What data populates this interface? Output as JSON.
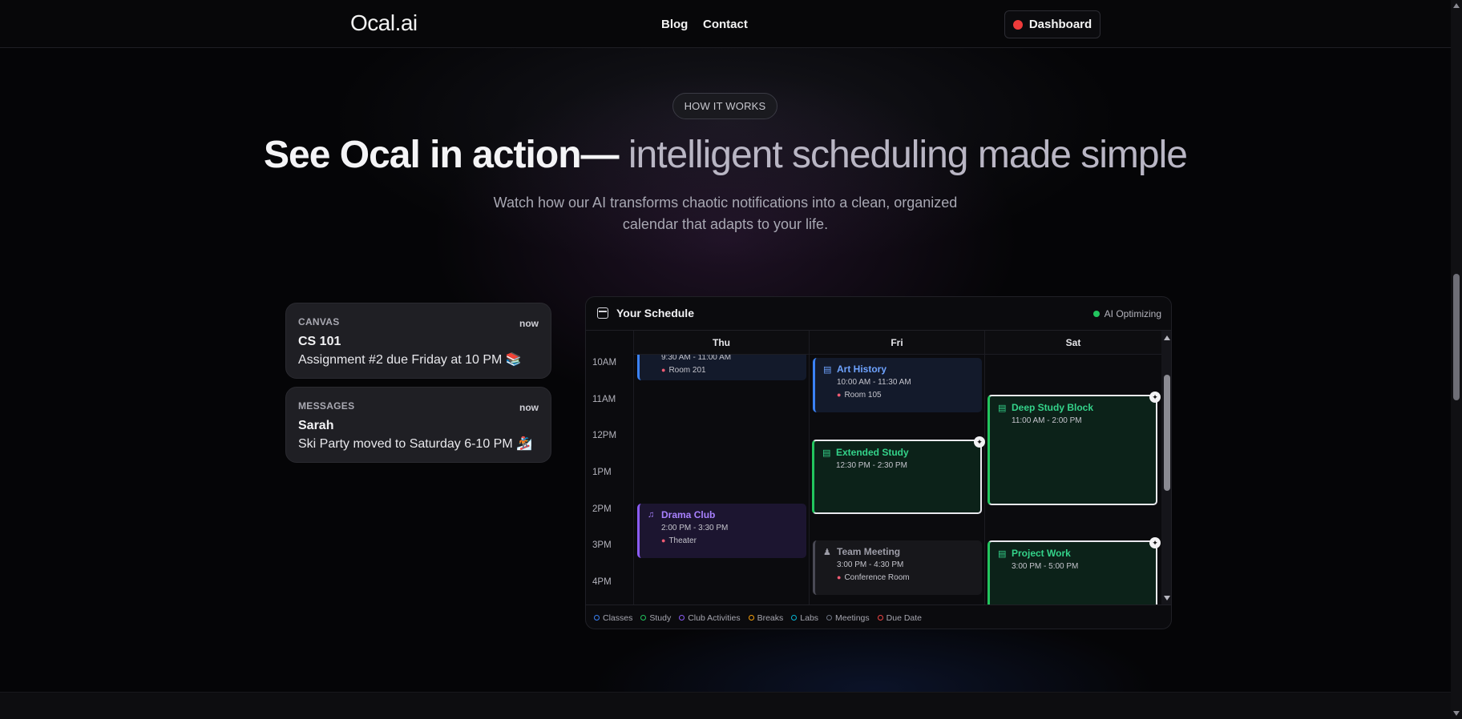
{
  "nav": {
    "logo": "Ocal.ai",
    "links": [
      "Blog",
      "Contact"
    ],
    "dashboard": "Dashboard"
  },
  "hero": {
    "pill": "HOW IT WORKS",
    "headline_white": "See Ocal in action— ",
    "headline_gray": "intelligent scheduling made simple",
    "subtitle_line1": "Watch how our AI transforms chaotic notifications into a clean, organized",
    "subtitle_line2": "calendar that adapts to your life."
  },
  "notifications": [
    {
      "app": "CANVAS",
      "time": "now",
      "title": "CS 101",
      "body": "Assignment #2 due Friday at 10 PM 📚"
    },
    {
      "app": "MESSAGES",
      "time": "now",
      "title": "Sarah",
      "body": "Ski Party moved to Saturday 6-10 PM 🏂"
    }
  ],
  "schedule": {
    "title": "Your Schedule",
    "status": "AI Optimizing",
    "times": [
      "10AM",
      "11AM",
      "12PM",
      "1PM",
      "2PM",
      "3PM",
      "4PM"
    ],
    "days": [
      "Thu",
      "Fri",
      "Sat"
    ],
    "events": {
      "thu_class": {
        "time": "9:30 AM - 11:00 AM",
        "location": "Room 201"
      },
      "drama": {
        "title": "Drama Club",
        "time": "2:00 PM - 3:30 PM",
        "location": "Theater"
      },
      "art": {
        "title": "Art History",
        "time": "10:00 AM - 11:30 AM",
        "location": "Room 105"
      },
      "extended": {
        "title": "Extended Study",
        "time": "12:30 PM - 2:30 PM"
      },
      "team": {
        "title": "Team Meeting",
        "time": "3:00 PM - 4:30 PM",
        "location": "Conference Room"
      },
      "deep": {
        "title": "Deep Study Block",
        "time": "11:00 AM - 2:00 PM"
      },
      "project": {
        "title": "Project Work",
        "time": "3:00 PM - 5:00 PM"
      }
    },
    "legend": [
      {
        "label": "Classes",
        "color": "#3b82f6"
      },
      {
        "label": "Study",
        "color": "#22c55e"
      },
      {
        "label": "Club Activities",
        "color": "#8b5cf6"
      },
      {
        "label": "Breaks",
        "color": "#f59e0b"
      },
      {
        "label": "Labs",
        "color": "#06b6d4"
      },
      {
        "label": "Meetings",
        "color": "#6b7280"
      },
      {
        "label": "Due Date",
        "color": "#ef4444"
      }
    ]
  }
}
